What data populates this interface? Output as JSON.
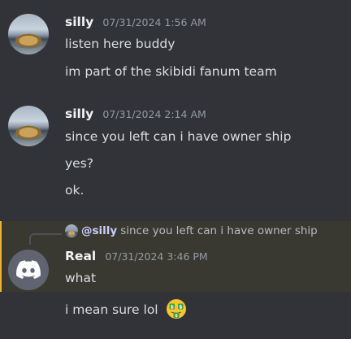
{
  "messages": [
    {
      "username": "silly",
      "timestamp": "07/31/2024 1:56 AM",
      "lines": [
        "listen here buddy",
        "im part of the skibidi fanum team"
      ]
    },
    {
      "username": "silly",
      "timestamp": "07/31/2024 2:14 AM",
      "lines": [
        "since you left can i have owner ship",
        "yes?",
        "ok."
      ]
    },
    {
      "reply": {
        "mention": "@silly",
        "text": "since you left can i have owner ship"
      },
      "username": "Real",
      "timestamp": "07/31/2024 3:46 PM",
      "lines": [
        "what",
        "i mean sure lol"
      ],
      "emoji": "money-mouth-face"
    }
  ]
}
